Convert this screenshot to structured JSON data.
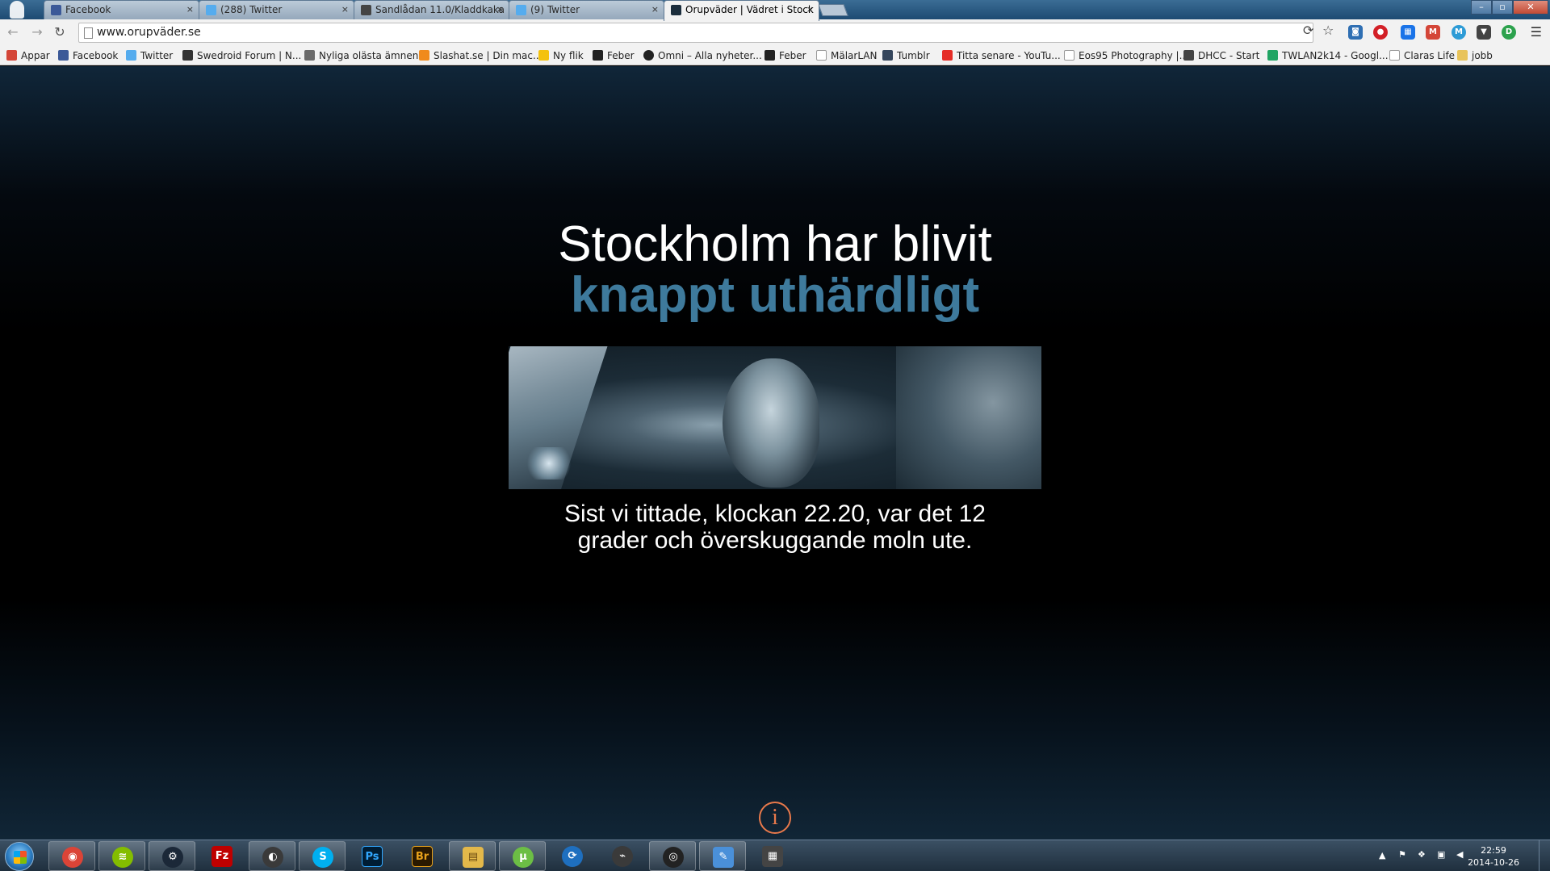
{
  "browser": {
    "tabs": [
      {
        "label": "Facebook",
        "icon": "facebook-icon",
        "color": "#3b5998",
        "active": false
      },
      {
        "label": "(288) Twitter",
        "icon": "twitter-icon",
        "color": "#55acee",
        "active": false
      },
      {
        "label": "Sandlådan 11.0/Kladdkaka",
        "icon": "forum-icon",
        "color": "#444444",
        "active": false
      },
      {
        "label": "(9) Twitter",
        "icon": "twitter-icon",
        "color": "#55acee",
        "active": false
      },
      {
        "label": "Orupväder | Vädret i Stock",
        "icon": "orupvader-icon",
        "color": "#1b2d3c",
        "active": true
      }
    ],
    "close_glyph": "×",
    "window_controls": [
      "–",
      "▫",
      "✕"
    ],
    "url": "www.orupväder.se"
  },
  "bookmarks": [
    {
      "label": "Appar",
      "icon": "apps-icon",
      "color": "#d44638"
    },
    {
      "label": "Facebook",
      "icon": "facebook-icon",
      "color": "#3b5998"
    },
    {
      "label": "Twitter",
      "icon": "twitter-icon",
      "color": "#55acee"
    },
    {
      "label": "Swedroid Forum | N...",
      "icon": "swedroid-icon",
      "color": "#333333"
    },
    {
      "label": "Nyliga olästa ämnen",
      "icon": "tw-icon",
      "color": "#6a6a6a"
    },
    {
      "label": "Slashat.se | Din mac...",
      "icon": "slashat-icon",
      "color": "#f08a1c"
    },
    {
      "label": "Ny flik",
      "icon": "newtab-icon",
      "color": "#f4c20d"
    },
    {
      "label": "Feber",
      "icon": "feber-icon",
      "color": "#222222"
    },
    {
      "label": "Omni – Alla nyheter...",
      "icon": "omni-icon",
      "color": "#222222"
    },
    {
      "label": "Feber",
      "icon": "feber-icon",
      "color": "#222222"
    },
    {
      "label": "MälarLAN",
      "icon": "page-icon",
      "color": "#9a9a9a"
    },
    {
      "label": "Tumblr",
      "icon": "tumblr-icon",
      "color": "#35465c"
    },
    {
      "label": "Titta senare - YouTu...",
      "icon": "youtube-icon",
      "color": "#e52d27"
    },
    {
      "label": "Eos95 Photography |...",
      "icon": "page-icon",
      "color": "#9a9a9a"
    },
    {
      "label": "DHCC - Start",
      "icon": "dhcc-icon",
      "color": "#444444"
    },
    {
      "label": "TWLAN2k14 - Googl...",
      "icon": "drive-icon",
      "color": "#1fa463"
    },
    {
      "label": "Claras Life",
      "icon": "page-icon",
      "color": "#9a9a9a"
    },
    {
      "label": "jobb",
      "icon": "folder-icon",
      "color": "#e8c35a"
    }
  ],
  "page": {
    "headline_line1": "Stockholm har blivit",
    "headline_line2": "knappt uthärdligt",
    "description": "Sist vi tittade, klockan 22.20, var det 12 grader och överskuggande moln ute.",
    "info_glyph": "i",
    "accent_color": "#3e7a9c",
    "info_color": "#e8794b"
  },
  "taskbar": {
    "apps": [
      {
        "name": "chrome",
        "glyph": "◉",
        "color": "#db4437"
      },
      {
        "name": "spotify",
        "glyph": "≋",
        "color": "#84bd00"
      },
      {
        "name": "steam",
        "glyph": "⚙",
        "color": "#1b2838"
      },
      {
        "name": "filezilla",
        "glyph": "Fz",
        "color": "#bf0000"
      },
      {
        "name": "steelseries",
        "glyph": "◐",
        "color": "#3a3a3a"
      },
      {
        "name": "skype",
        "glyph": "S",
        "color": "#00aff0"
      },
      {
        "name": "photoshop",
        "glyph": "Ps",
        "color": "#001d34"
      },
      {
        "name": "bridge",
        "glyph": "Br",
        "color": "#2a1900"
      },
      {
        "name": "explorer",
        "glyph": "▤",
        "color": "#e3b84a"
      },
      {
        "name": "utorrent",
        "glyph": "µ",
        "color": "#6cbe45"
      },
      {
        "name": "sync",
        "glyph": "⟳",
        "color": "#1e6fbf"
      },
      {
        "name": "satellite",
        "glyph": "⌁",
        "color": "#3a3a3a"
      },
      {
        "name": "camera",
        "glyph": "◎",
        "color": "#222222"
      },
      {
        "name": "notepad",
        "glyph": "✎",
        "color": "#4a90d9"
      },
      {
        "name": "media",
        "glyph": "▦",
        "color": "#444444"
      }
    ],
    "time": "22:59",
    "date": "2014-10-26"
  }
}
